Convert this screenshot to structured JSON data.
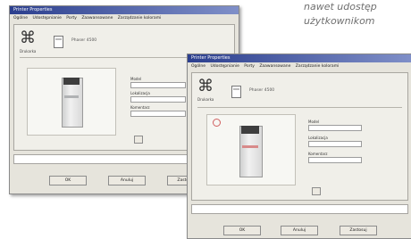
{
  "caption": {
    "line1": "nawet udostęp",
    "line2": "użytkownikom"
  },
  "back_window": {
    "title": "Printer Properties",
    "tabs": [
      "Ogólne",
      "Udostępnianie",
      "Porty",
      "Zaawansowane",
      "Zarządzanie kolorami"
    ],
    "printer_name": "Phaser 4500",
    "icon_label": "Drukarka",
    "fields": [
      "Model",
      "Lokalizacja",
      "Komentarz"
    ],
    "buttons": {
      "ok": "OK",
      "cancel": "Anuluj",
      "apply": "Zastosuj"
    }
  },
  "front_window": {
    "title": "Printer Properties",
    "tabs": [
      "Ogólne",
      "Udostępnianie",
      "Porty",
      "Zaawansowane",
      "Zarządzanie kolorami"
    ],
    "printer_name": "Phaser 4500",
    "icon_label": "Drukarka",
    "fields": [
      "Model",
      "Lokalizacja",
      "Komentarz"
    ],
    "buttons": {
      "ok": "OK",
      "cancel": "Anuluj",
      "apply": "Zastosuj"
    }
  },
  "colors": {
    "titlebar": "#2c3f8e",
    "window": "#e6e4dc",
    "accent_red": "#d06060"
  }
}
